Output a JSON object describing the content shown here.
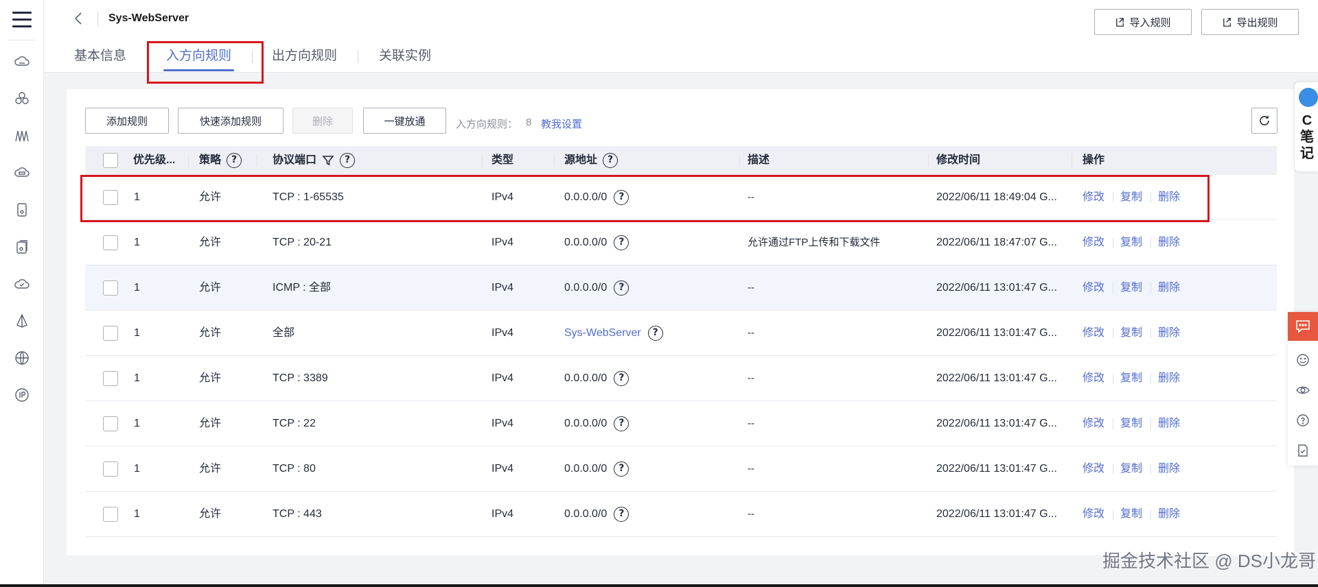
{
  "sidebar": {
    "icons": [
      "menu-icon",
      "cloud-server-icon",
      "cluster-icon",
      "network-icon",
      "cloud-disk-icon",
      "storage-icon",
      "backup-icon",
      "cloud-check-icon",
      "vpn-icon",
      "web-globe-icon",
      "ip-icon"
    ]
  },
  "header": {
    "title": "Sys-WebServer",
    "import_label": "导入规则",
    "export_label": "导出规则",
    "tabs": [
      {
        "label": "基本信息",
        "active": false
      },
      {
        "label": "入方向规则",
        "active": true
      },
      {
        "label": "出方向规则",
        "active": false
      },
      {
        "label": "关联实例",
        "active": false
      }
    ]
  },
  "toolbar": {
    "add_rule": "添加规则",
    "quick_add_rule": "快速添加规则",
    "delete": "删除",
    "one_click": "一键放通",
    "count_label": "入方向规则：",
    "count_value": "8",
    "help_link": "教我设置"
  },
  "table": {
    "columns": [
      "优先级...",
      "策略",
      "协议端口",
      "类型",
      "源地址",
      "描述",
      "修改时间",
      "操作"
    ],
    "actions": [
      "修改",
      "复制",
      "删除"
    ],
    "rows": [
      {
        "priority": "1",
        "policy": "允许",
        "port": "TCP : 1-65535",
        "type": "IPv4",
        "source": "0.0.0.0/0",
        "source_link": false,
        "desc": "--",
        "time": "2022/06/11 18:49:04 G..."
      },
      {
        "priority": "1",
        "policy": "允许",
        "port": "TCP : 20-21",
        "type": "IPv4",
        "source": "0.0.0.0/0",
        "source_link": false,
        "desc": "允许通过FTP上传和下载文件",
        "time": "2022/06/11 18:47:07 G..."
      },
      {
        "priority": "1",
        "policy": "允许",
        "port": "ICMP : 全部",
        "type": "IPv4",
        "source": "0.0.0.0/0",
        "source_link": false,
        "desc": "--",
        "time": "2022/06/11 13:01:47 G..."
      },
      {
        "priority": "1",
        "policy": "允许",
        "port": "全部",
        "type": "IPv4",
        "source": "Sys-WebServer",
        "source_link": true,
        "desc": "--",
        "time": "2022/06/11 13:01:47 G..."
      },
      {
        "priority": "1",
        "policy": "允许",
        "port": "TCP : 3389",
        "type": "IPv4",
        "source": "0.0.0.0/0",
        "source_link": false,
        "desc": "--",
        "time": "2022/06/11 13:01:47 G..."
      },
      {
        "priority": "1",
        "policy": "允许",
        "port": "TCP : 22",
        "type": "IPv4",
        "source": "0.0.0.0/0",
        "source_link": false,
        "desc": "--",
        "time": "2022/06/11 13:01:47 G..."
      },
      {
        "priority": "1",
        "policy": "允许",
        "port": "TCP : 80",
        "type": "IPv4",
        "source": "0.0.0.0/0",
        "source_link": false,
        "desc": "--",
        "time": "2022/06/11 13:01:47 G..."
      },
      {
        "priority": "1",
        "policy": "允许",
        "port": "TCP : 443",
        "type": "IPv4",
        "source": "0.0.0.0/0",
        "source_link": false,
        "desc": "--",
        "time": "2022/06/11 13:01:47 G..."
      }
    ]
  },
  "floating": {
    "notes_text": "C笔记",
    "icons": [
      "chat-icon",
      "smile-icon",
      "eye-icon",
      "help-icon",
      "feedback-icon"
    ]
  },
  "watermark": "掘金技术社区 @ DS小龙哥",
  "colors": {
    "accent": "#526ecc",
    "highlight": "#d8141c",
    "chat": "#e8573f"
  }
}
